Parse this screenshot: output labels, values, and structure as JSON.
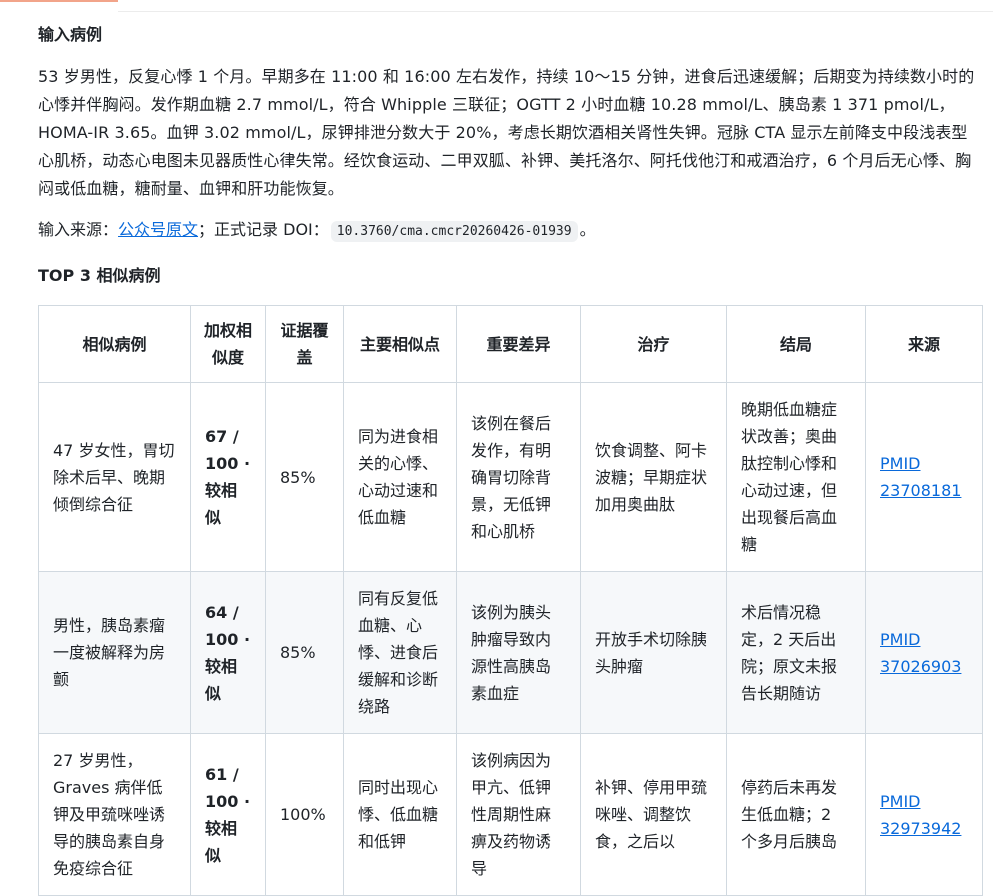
{
  "section_title": "输入病例",
  "case_text": "53 岁男性，反复心悸 1 个月。早期多在 11:00 和 16:00 左右发作，持续 10～15 分钟，进食后迅速缓解；后期变为持续数小时的心悸并伴胸闷。发作期血糖 2.7 mmol/L，符合 Whipple 三联征；OGTT 2 小时血糖 10.28 mmol/L、胰岛素 1 371 pmol/L，HOMA-IR 3.65。血钾 3.02 mmol/L，尿钾排泄分数大于 20%，考虑长期饮酒相关肾性失钾。冠脉 CTA 显示左前降支中段浅表型心肌桥，动态心电图未见器质性心律失常。经饮食运动、二甲双胍、补钾、美托洛尔、阿托伐他汀和戒酒治疗，6 个月后无心悸、胸闷或低血糖，糖耐量、血钾和肝功能恢复。",
  "source": {
    "prefix": "输入来源：",
    "link_text": "公众号原文",
    "middle": "；正式记录 DOI：",
    "doi": "10.3760/cma.cmcr20260426-01939",
    "suffix": "。"
  },
  "top3_title": "TOP 3 相似病例",
  "table": {
    "headers": [
      "相似病例",
      "加权相似度",
      "证据覆盖",
      "主要相似点",
      "重要差异",
      "治疗",
      "结局",
      "来源"
    ],
    "rows": [
      {
        "case": "47 岁女性，胃切除术后早、晚期倾倒综合征",
        "score": "67 / 100 · 较相似",
        "coverage": "85%",
        "similarity": "同为进食相关的心悸、心动过速和低血糖",
        "difference": "该例在餐后发作，有明确胃切除背景，无低钾和心肌桥",
        "treatment": "饮食调整、阿卡波糖；早期症状加用奥曲肽",
        "outcome": "晚期低血糖症状改善；奥曲肽控制心悸和心动过速，但出现餐后高血糖",
        "source": "PMID 23708181"
      },
      {
        "case": "男性，胰岛素瘤一度被解释为房颤",
        "score": "64 / 100 · 较相似",
        "coverage": "85%",
        "similarity": "同有反复低血糖、心悸、进食后缓解和诊断绕路",
        "difference": "该例为胰头肿瘤导致内源性高胰岛素血症",
        "treatment": "开放手术切除胰头肿瘤",
        "outcome": "术后情况稳定，2 天后出院；原文未报告长期随访",
        "source": "PMID 37026903"
      },
      {
        "case": "27 岁男性，Graves 病伴低钾及甲巯咪唑诱导的胰岛素自身免疫综合征",
        "score": "61 / 100 · 较相似",
        "coverage": "100%",
        "similarity": "同时出现心悸、低血糖和低钾",
        "difference": "该例病因为甲亢、低钾性周期性麻痹及药物诱导",
        "treatment": "补钾、停用甲巯咪唑、调整饮食，之后以",
        "outcome": "停药后未再发生低血糖；2 个多月后胰岛",
        "source": "PMID 32973942"
      }
    ]
  }
}
